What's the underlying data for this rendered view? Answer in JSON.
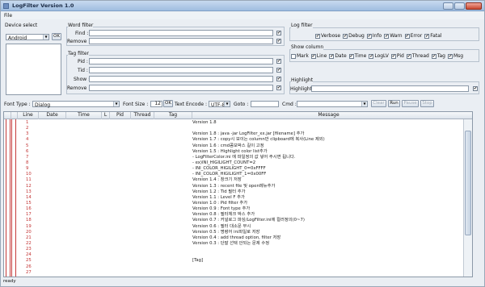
{
  "window": {
    "title": "LogFilter Version 1.0"
  },
  "menu": {
    "file": "File"
  },
  "device": {
    "title": "Device select",
    "selected": "Android",
    "ok": "OK"
  },
  "word_filter": {
    "title": "Word filter",
    "find_label": "Find :",
    "remove_label": "Remove :"
  },
  "tag_filter": {
    "title": "Tag filter",
    "pid_label": "Pid :",
    "tid_label": "Tid :",
    "show_label": "Show :",
    "remove_label": "Remove :"
  },
  "log_filter": {
    "title": "Log filter",
    "items": [
      "Verbose",
      "Debug",
      "Info",
      "Warn",
      "Error",
      "Fatal"
    ]
  },
  "show_column": {
    "title": "Show column",
    "items": [
      "Mark",
      "Line",
      "Date",
      "Time",
      "LogLV",
      "Pid",
      "Thread",
      "Tag",
      "Msg"
    ]
  },
  "highlight": {
    "title": "Highlight",
    "label": "Highlight :"
  },
  "toolbar": {
    "font_type_label": "Font Type :",
    "font_type_value": "Dialog",
    "font_size_label": "Font Size :",
    "font_size_value": "12",
    "ok": "OK",
    "text_encode_label": "Text Encode :",
    "text_encode_value": "UTF-8",
    "goto_label": "Goto :",
    "cmd_label": "Cmd :",
    "clear": "Clear",
    "run": "Run",
    "pause": "Pause",
    "stop": "Stop"
  },
  "table": {
    "columns": [
      "Line",
      "Date",
      "Time",
      "L",
      "Pid",
      "Thread",
      "Tag",
      "Message"
    ],
    "rows": [
      {
        "line": "1",
        "msg": "Version 1.8"
      },
      {
        "line": "2",
        "msg": ""
      },
      {
        "line": "3",
        "msg": "Version 1.8 : java -jar LogFilter_xx.jar [filename] 추가"
      },
      {
        "line": "4",
        "msg": "Version 1.7 : copy시 보이는 column만 clipboard에 복사(Line 제외)"
      },
      {
        "line": "5",
        "msg": "Version 1.6 : cmd콤보박스 길이 고정"
      },
      {
        "line": "6",
        "msg": "Version 1.5 : Highlight color list추가"
      },
      {
        "line": "7",
        "msg": "  - LogFilterColor.ini 에 파일정의 값 넣어 주시면 됩니다."
      },
      {
        "line": "8",
        "msg": "  - ex)INI_HIGILIGHT_COUNT=2"
      },
      {
        "line": "9",
        "msg": "  -  INI_COLOR_HIGILIGHT_0=0xFFFF"
      },
      {
        "line": "10",
        "msg": "  -  INI_COLOR_HIGILIGHT_1=0x00FF"
      },
      {
        "line": "11",
        "msg": "Version 1.4 : 창크기 저장"
      },
      {
        "line": "12",
        "msg": "Version 1.3 : recent file 및 open메뉴추가"
      },
      {
        "line": "13",
        "msg": "Version 1.2 : Tid 필터 추가"
      },
      {
        "line": "14",
        "msg": "Version 1.1 : Level F 추가"
      },
      {
        "line": "15",
        "msg": "Version 1.0 : Pid filter 추가"
      },
      {
        "line": "16",
        "msg": "Version 0.9 : Font type 추가"
      },
      {
        "line": "17",
        "msg": "Version 0.8 : 필터체크 박스 추가"
      },
      {
        "line": "18",
        "msg": "Version 0.7 : 커널로그 파싱/LogFilter.ini에 컬러정의(0~7)"
      },
      {
        "line": "19",
        "msg": "Version 0.6 : 필터 대소문 무시"
      },
      {
        "line": "20",
        "msg": "Version 0.5 : 명령어 ini파일로 저장"
      },
      {
        "line": "21",
        "msg": "Version 0.4 : add thread option, filter 저장"
      },
      {
        "line": "22",
        "msg": "Version 0.3 : 단말 선택 안되는 문제 수정"
      },
      {
        "line": "23",
        "msg": ""
      },
      {
        "line": "24",
        "msg": ""
      },
      {
        "line": "25",
        "msg": "[Tag]"
      },
      {
        "line": "26",
        "msg": ""
      },
      {
        "line": "27",
        "msg": ""
      }
    ]
  },
  "status": "ready"
}
